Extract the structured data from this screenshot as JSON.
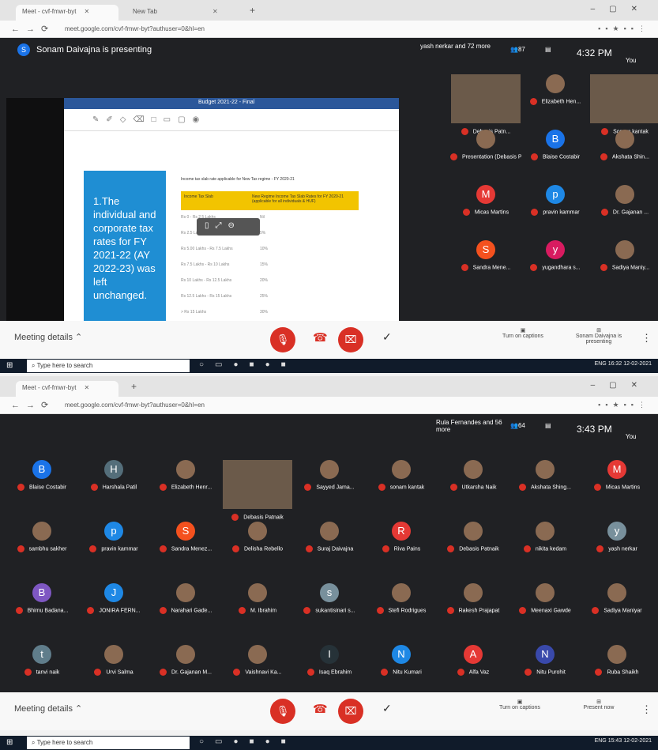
{
  "shot1": {
    "tabs": [
      {
        "label": "Meet - cvf-fmwr-byt",
        "active": true
      },
      {
        "label": "New Tab",
        "active": false
      }
    ],
    "url": "meet.google.com/cvf-fmwr-byt?authuser=0&hl=en",
    "presenting_text": "Sonam Daivajna is presenting",
    "presenter_initial": "S",
    "others_text": "yash nerkar and 72 more",
    "people_count": "87",
    "time": "4:32 PM",
    "you_label": "You",
    "doc_title": "Budget 2021-22 - Final",
    "slide_text": "1.The individual and corporate tax rates for FY 2021-22 (AY 2022-23) was left unchanged.",
    "table_title": "Income tax slab rate applicable for New Tax regime - FY 2020-21",
    "table_header_left": "Income Tax Slab",
    "table_header_right": "New Regime Income Tax Slab Rates for FY 2020-21 (applicable for all individuals & HUF)",
    "table_rows": [
      [
        "Rs 0 - Rs 2.5 Lakhs",
        "Nil"
      ],
      [
        "Rs 2.5 Lakhs - Rs 5.00 Lakhs",
        "5%"
      ],
      [
        "Rs 5.00 Lakhs - Rs 7.5 Lakhs",
        "10%"
      ],
      [
        "Rs 7.5 Lakhs - Rs 10 Lakhs",
        "15%"
      ],
      [
        "Rs 10 Lakhs - Rs 12.5 Lakhs",
        "20%"
      ],
      [
        "Rs 12.5 Lakhs - Rs 15 Lakhs",
        "25%"
      ],
      [
        "> Rs 15 Lakhs",
        "30%"
      ]
    ],
    "participants": [
      {
        "name": "Debasis Patn...",
        "type": "video"
      },
      {
        "name": "Elizabeth Hen...",
        "type": "photo"
      },
      {
        "name": "Sonam kantak",
        "type": "video"
      },
      {
        "name": "Presentation (Debasis Pat...",
        "type": "photo"
      },
      {
        "name": "Blaise Costabir",
        "type": "initial",
        "initial": "B",
        "color": "#1a73e8"
      },
      {
        "name": "Akshata Shin...",
        "type": "photo"
      },
      {
        "name": "Micas Martins",
        "type": "initial",
        "initial": "M",
        "color": "#e53935"
      },
      {
        "name": "pravin kammar",
        "type": "initial",
        "initial": "p",
        "color": "#1e88e5"
      },
      {
        "name": "Dr. Gajanan ...",
        "type": "photo"
      },
      {
        "name": "Sandra Mene...",
        "type": "initial",
        "initial": "S",
        "color": "#f4511e"
      },
      {
        "name": "yugandhara s...",
        "type": "initial",
        "initial": "y",
        "color": "#d81b60"
      },
      {
        "name": "Sadiya Maniy...",
        "type": "photo"
      }
    ],
    "meeting_details": "Meeting details",
    "captions": "Turn on captions",
    "present_label": "Sonam Daivajna is presenting",
    "taskbar_search": "Type here to search",
    "tray_time": "16:32",
    "tray_date": "12-02-2021",
    "tray_lang": "ENG"
  },
  "shot2": {
    "tabs": [
      {
        "label": "Meet - cvf-fmwr-byt",
        "active": true
      }
    ],
    "url": "meet.google.com/cvf-fmwr-byt?authuser=0&hl=en",
    "others_text": "Rula Fernandes and 56 more",
    "people_count": "64",
    "time": "3:43 PM",
    "you_label": "You",
    "participants": [
      {
        "name": "Blaise Costabir",
        "type": "initial",
        "initial": "B",
        "color": "#1a73e8"
      },
      {
        "name": "Harshala Patil",
        "type": "initial",
        "initial": "H",
        "color": "#546e7a"
      },
      {
        "name": "Elizabeth Henr...",
        "type": "photo"
      },
      {
        "name": "Debasis Patnaik",
        "type": "video"
      },
      {
        "name": "Sayyed Jama...",
        "type": "photo"
      },
      {
        "name": "sonam kantak",
        "type": "photo"
      },
      {
        "name": "Utkarsha Naik",
        "type": "photo"
      },
      {
        "name": "Akshata Shing...",
        "type": "photo"
      },
      {
        "name": "Micas Martins",
        "type": "initial",
        "initial": "M",
        "color": "#e53935"
      },
      {
        "name": "sambhu sakher",
        "type": "photo"
      },
      {
        "name": "pravin kammar",
        "type": "initial",
        "initial": "p",
        "color": "#1e88e5"
      },
      {
        "name": "Sandra Menez...",
        "type": "initial",
        "initial": "S",
        "color": "#f4511e"
      },
      {
        "name": "Delisha Rebello",
        "type": "photo"
      },
      {
        "name": "Suraj Daivajna",
        "type": "photo"
      },
      {
        "name": "Riva Pains",
        "type": "initial",
        "initial": "R",
        "color": "#e53935"
      },
      {
        "name": "Debasis Patnaik",
        "type": "photo"
      },
      {
        "name": "nikita kedam",
        "type": "photo"
      },
      {
        "name": "yash nerkar",
        "type": "initial",
        "initial": "y",
        "color": "#78909c"
      },
      {
        "name": "Bhimu Badana...",
        "type": "initial",
        "initial": "B",
        "color": "#7e57c2"
      },
      {
        "name": "JONIRA FERN...",
        "type": "initial",
        "initial": "J",
        "color": "#1e88e5"
      },
      {
        "name": "Narahari Gade...",
        "type": "photo"
      },
      {
        "name": "M. Ibrahim",
        "type": "photo"
      },
      {
        "name": "sukantisinari s...",
        "type": "initial",
        "initial": "s",
        "color": "#78909c"
      },
      {
        "name": "Stefi Rodrigues",
        "type": "photo"
      },
      {
        "name": "Rakesh Prajapat",
        "type": "photo"
      },
      {
        "name": "Meenaxi Gawde",
        "type": "photo"
      },
      {
        "name": "Sadiya Maniyar",
        "type": "photo"
      },
      {
        "name": "tanvi naik",
        "type": "initial",
        "initial": "t",
        "color": "#607d8b"
      },
      {
        "name": "Urvi Salma",
        "type": "photo"
      },
      {
        "name": "Dr. Gajanan M...",
        "type": "photo"
      },
      {
        "name": "Vaishnavi Ka...",
        "type": "photo"
      },
      {
        "name": "Isaq Ebrahim",
        "type": "initial",
        "initial": "I",
        "color": "#263238"
      },
      {
        "name": "Nitu Kumari",
        "type": "initial",
        "initial": "N",
        "color": "#1e88e5"
      },
      {
        "name": "Alfa Vaz",
        "type": "initial",
        "initial": "A",
        "color": "#e53935"
      },
      {
        "name": "Nitu Purohit",
        "type": "initial",
        "initial": "N",
        "color": "#3949ab"
      },
      {
        "name": "Ruba Shaikh",
        "type": "photo"
      }
    ],
    "meeting_details": "Meeting details",
    "captions": "Turn on captions",
    "present_label": "Present now",
    "taskbar_search": "Type here to search",
    "tray_time": "15:43",
    "tray_date": "12-02-2021",
    "tray_lang": "ENG"
  }
}
